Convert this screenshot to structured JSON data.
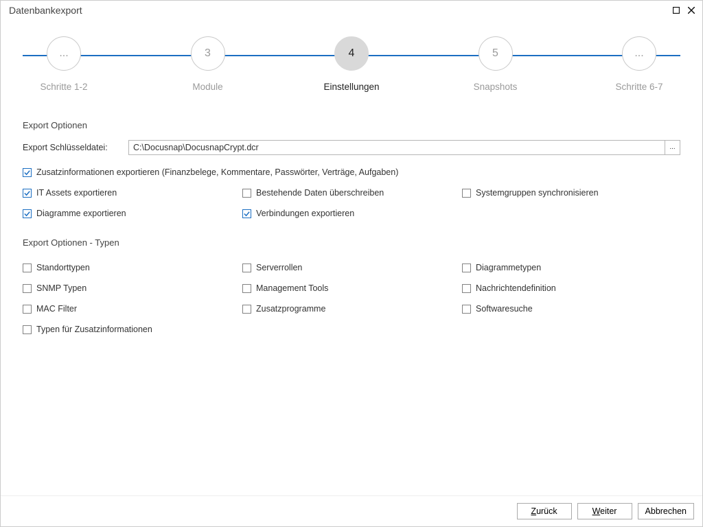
{
  "window": {
    "title": "Datenbankexport"
  },
  "stepper": {
    "steps": [
      {
        "badge": "...",
        "label": "Schritte 1-2",
        "active": false
      },
      {
        "badge": "3",
        "label": "Module",
        "active": false
      },
      {
        "badge": "4",
        "label": "Einstellungen",
        "active": true
      },
      {
        "badge": "5",
        "label": "Snapshots",
        "active": false
      },
      {
        "badge": "...",
        "label": "Schritte 6-7",
        "active": false
      }
    ]
  },
  "section_options_title": "Export Optionen",
  "keyfile": {
    "label": "Export Schlüsseldatei:",
    "value": "C:\\Docusnap\\DocusnapCrypt.dcr",
    "browse": "..."
  },
  "options": {
    "extra_info": {
      "label": "Zusatzinformationen exportieren (Finanzbelege, Kommentare, Passwörter, Verträge, Aufgaben)",
      "checked": true
    },
    "it_assets": {
      "label": "IT Assets exportieren",
      "checked": true
    },
    "overwrite": {
      "label": "Bestehende Daten überschreiben",
      "checked": false
    },
    "sync_sys": {
      "label": "Systemgruppen synchronisieren",
      "checked": false
    },
    "diagrams": {
      "label": "Diagramme exportieren",
      "checked": true
    },
    "connections": {
      "label": "Verbindungen exportieren",
      "checked": true
    }
  },
  "section_types_title": "Export Optionen - Typen",
  "types": {
    "location": {
      "label": "Standorttypen",
      "checked": false
    },
    "serverroles": {
      "label": "Serverrollen",
      "checked": false
    },
    "diagtypes": {
      "label": "Diagrammetypen",
      "checked": false
    },
    "snmp": {
      "label": "SNMP Typen",
      "checked": false
    },
    "mgmt": {
      "label": "Management Tools",
      "checked": false
    },
    "msgdef": {
      "label": "Nachrichtendefinition",
      "checked": false
    },
    "macfilter": {
      "label": "MAC Filter",
      "checked": false
    },
    "addprog": {
      "label": "Zusatzprogramme",
      "checked": false
    },
    "swsearch": {
      "label": "Softwaresuche",
      "checked": false
    },
    "extratypes": {
      "label": "Typen für Zusatzinformationen",
      "checked": false
    }
  },
  "footer": {
    "back": {
      "pre": "",
      "mn": "Z",
      "post": "urück"
    },
    "next": {
      "pre": "",
      "mn": "W",
      "post": "eiter"
    },
    "cancel": {
      "pre": "Abbrechen"
    }
  }
}
